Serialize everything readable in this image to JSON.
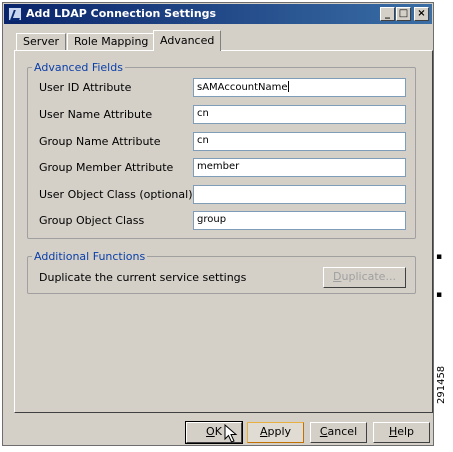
{
  "window": {
    "title": "Add LDAP Connection Settings"
  },
  "titlebar_buttons": {
    "minimize": "_",
    "maximize": "□",
    "close": "×"
  },
  "tabs": [
    {
      "label": "Server",
      "active": false
    },
    {
      "label": "Role Mapping",
      "active": false
    },
    {
      "label": "Advanced",
      "active": true
    }
  ],
  "advanced_fields": {
    "legend": "Advanced Fields",
    "rows": [
      {
        "label": "User ID Attribute",
        "value": "sAMAccountName"
      },
      {
        "label": "User Name Attribute",
        "value": "cn"
      },
      {
        "label": "Group Name Attribute",
        "value": "cn"
      },
      {
        "label": "Group Member Attribute",
        "value": "member"
      },
      {
        "label": "User Object Class (optional)",
        "value": ""
      },
      {
        "label": "Group Object Class",
        "value": "group"
      }
    ]
  },
  "additional_functions": {
    "legend": "Additional Functions",
    "description": "Duplicate the current service settings",
    "duplicate_rest": "uplicate...",
    "duplicate_mnemonic": "D"
  },
  "footer": {
    "ok_label": "OK",
    "ok_mnemonic": "O",
    "ok_rest": "K",
    "apply_label": "Apply",
    "apply_mnemonic": "A",
    "apply_rest": "pply",
    "cancel_label": "Cancel",
    "cancel_mnemonic": "C",
    "cancel_rest": "ancel",
    "help_label": "Help",
    "help_mnemonic": "H",
    "help_rest": "elp"
  },
  "figure_id": "291458",
  "colors": {
    "title_start": "#0a246a",
    "title_end": "#3a6ea5",
    "legend_text": "#0a3ea8",
    "face": "#d4d0c8",
    "field_border": "#7f9db9"
  }
}
